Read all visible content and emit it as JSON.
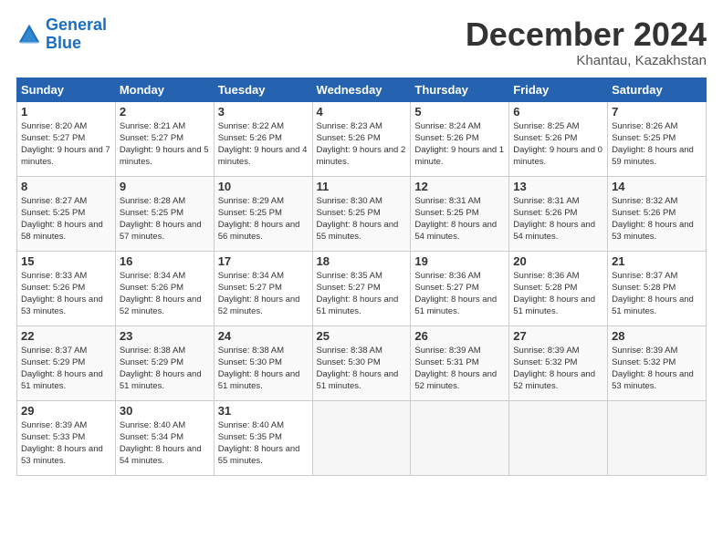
{
  "logo": {
    "line1": "General",
    "line2": "Blue"
  },
  "header": {
    "month": "December 2024",
    "location": "Khantau, Kazakhstan"
  },
  "weekdays": [
    "Sunday",
    "Monday",
    "Tuesday",
    "Wednesday",
    "Thursday",
    "Friday",
    "Saturday"
  ],
  "weeks": [
    [
      {
        "day": "1",
        "sunrise": "Sunrise: 8:20 AM",
        "sunset": "Sunset: 5:27 PM",
        "daylight": "Daylight: 9 hours and 7 minutes."
      },
      {
        "day": "2",
        "sunrise": "Sunrise: 8:21 AM",
        "sunset": "Sunset: 5:27 PM",
        "daylight": "Daylight: 9 hours and 5 minutes."
      },
      {
        "day": "3",
        "sunrise": "Sunrise: 8:22 AM",
        "sunset": "Sunset: 5:26 PM",
        "daylight": "Daylight: 9 hours and 4 minutes."
      },
      {
        "day": "4",
        "sunrise": "Sunrise: 8:23 AM",
        "sunset": "Sunset: 5:26 PM",
        "daylight": "Daylight: 9 hours and 2 minutes."
      },
      {
        "day": "5",
        "sunrise": "Sunrise: 8:24 AM",
        "sunset": "Sunset: 5:26 PM",
        "daylight": "Daylight: 9 hours and 1 minute."
      },
      {
        "day": "6",
        "sunrise": "Sunrise: 8:25 AM",
        "sunset": "Sunset: 5:26 PM",
        "daylight": "Daylight: 9 hours and 0 minutes."
      },
      {
        "day": "7",
        "sunrise": "Sunrise: 8:26 AM",
        "sunset": "Sunset: 5:25 PM",
        "daylight": "Daylight: 8 hours and 59 minutes."
      }
    ],
    [
      {
        "day": "8",
        "sunrise": "Sunrise: 8:27 AM",
        "sunset": "Sunset: 5:25 PM",
        "daylight": "Daylight: 8 hours and 58 minutes."
      },
      {
        "day": "9",
        "sunrise": "Sunrise: 8:28 AM",
        "sunset": "Sunset: 5:25 PM",
        "daylight": "Daylight: 8 hours and 57 minutes."
      },
      {
        "day": "10",
        "sunrise": "Sunrise: 8:29 AM",
        "sunset": "Sunset: 5:25 PM",
        "daylight": "Daylight: 8 hours and 56 minutes."
      },
      {
        "day": "11",
        "sunrise": "Sunrise: 8:30 AM",
        "sunset": "Sunset: 5:25 PM",
        "daylight": "Daylight: 8 hours and 55 minutes."
      },
      {
        "day": "12",
        "sunrise": "Sunrise: 8:31 AM",
        "sunset": "Sunset: 5:25 PM",
        "daylight": "Daylight: 8 hours and 54 minutes."
      },
      {
        "day": "13",
        "sunrise": "Sunrise: 8:31 AM",
        "sunset": "Sunset: 5:26 PM",
        "daylight": "Daylight: 8 hours and 54 minutes."
      },
      {
        "day": "14",
        "sunrise": "Sunrise: 8:32 AM",
        "sunset": "Sunset: 5:26 PM",
        "daylight": "Daylight: 8 hours and 53 minutes."
      }
    ],
    [
      {
        "day": "15",
        "sunrise": "Sunrise: 8:33 AM",
        "sunset": "Sunset: 5:26 PM",
        "daylight": "Daylight: 8 hours and 53 minutes."
      },
      {
        "day": "16",
        "sunrise": "Sunrise: 8:34 AM",
        "sunset": "Sunset: 5:26 PM",
        "daylight": "Daylight: 8 hours and 52 minutes."
      },
      {
        "day": "17",
        "sunrise": "Sunrise: 8:34 AM",
        "sunset": "Sunset: 5:27 PM",
        "daylight": "Daylight: 8 hours and 52 minutes."
      },
      {
        "day": "18",
        "sunrise": "Sunrise: 8:35 AM",
        "sunset": "Sunset: 5:27 PM",
        "daylight": "Daylight: 8 hours and 51 minutes."
      },
      {
        "day": "19",
        "sunrise": "Sunrise: 8:36 AM",
        "sunset": "Sunset: 5:27 PM",
        "daylight": "Daylight: 8 hours and 51 minutes."
      },
      {
        "day": "20",
        "sunrise": "Sunrise: 8:36 AM",
        "sunset": "Sunset: 5:28 PM",
        "daylight": "Daylight: 8 hours and 51 minutes."
      },
      {
        "day": "21",
        "sunrise": "Sunrise: 8:37 AM",
        "sunset": "Sunset: 5:28 PM",
        "daylight": "Daylight: 8 hours and 51 minutes."
      }
    ],
    [
      {
        "day": "22",
        "sunrise": "Sunrise: 8:37 AM",
        "sunset": "Sunset: 5:29 PM",
        "daylight": "Daylight: 8 hours and 51 minutes."
      },
      {
        "day": "23",
        "sunrise": "Sunrise: 8:38 AM",
        "sunset": "Sunset: 5:29 PM",
        "daylight": "Daylight: 8 hours and 51 minutes."
      },
      {
        "day": "24",
        "sunrise": "Sunrise: 8:38 AM",
        "sunset": "Sunset: 5:30 PM",
        "daylight": "Daylight: 8 hours and 51 minutes."
      },
      {
        "day": "25",
        "sunrise": "Sunrise: 8:38 AM",
        "sunset": "Sunset: 5:30 PM",
        "daylight": "Daylight: 8 hours and 51 minutes."
      },
      {
        "day": "26",
        "sunrise": "Sunrise: 8:39 AM",
        "sunset": "Sunset: 5:31 PM",
        "daylight": "Daylight: 8 hours and 52 minutes."
      },
      {
        "day": "27",
        "sunrise": "Sunrise: 8:39 AM",
        "sunset": "Sunset: 5:32 PM",
        "daylight": "Daylight: 8 hours and 52 minutes."
      },
      {
        "day": "28",
        "sunrise": "Sunrise: 8:39 AM",
        "sunset": "Sunset: 5:32 PM",
        "daylight": "Daylight: 8 hours and 53 minutes."
      }
    ],
    [
      {
        "day": "29",
        "sunrise": "Sunrise: 8:39 AM",
        "sunset": "Sunset: 5:33 PM",
        "daylight": "Daylight: 8 hours and 53 minutes."
      },
      {
        "day": "30",
        "sunrise": "Sunrise: 8:40 AM",
        "sunset": "Sunset: 5:34 PM",
        "daylight": "Daylight: 8 hours and 54 minutes."
      },
      {
        "day": "31",
        "sunrise": "Sunrise: 8:40 AM",
        "sunset": "Sunset: 5:35 PM",
        "daylight": "Daylight: 8 hours and 55 minutes."
      },
      null,
      null,
      null,
      null
    ]
  ]
}
